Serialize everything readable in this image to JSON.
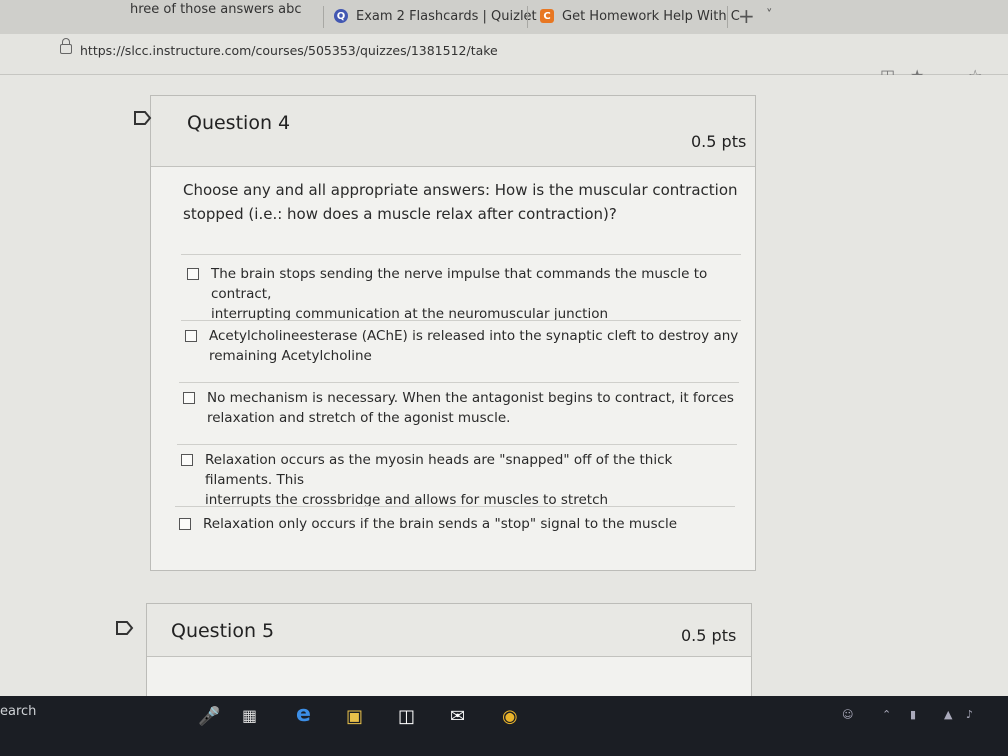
{
  "browser": {
    "tabs": [
      {
        "label": "hree of those answers abc",
        "icon": "browser-tab-icon"
      },
      {
        "label": "Exam 2 Flashcards | Quizlet",
        "icon": "quizlet-icon"
      },
      {
        "label": "Get Homework Help With C",
        "icon": "chegg-icon"
      }
    ],
    "new_tab": "+",
    "tab_menu": "˅",
    "url": "https://slcc.instructure.com/courses/505353/quizzes/1381512/take"
  },
  "questions": [
    {
      "title": "Question 4",
      "points": "0.5 pts",
      "text_line1": "Choose any and all appropriate answers: How is the muscular contraction",
      "text_line2": "stopped (i.e.: how does a muscle relax after contraction)?",
      "options": [
        {
          "line1": "The brain stops sending the nerve impulse that commands the muscle to contract,",
          "line2": "interrupting communication at the neuromuscular junction"
        },
        {
          "line1": "Acetylcholineesterase (AChE) is released into the synaptic cleft to destroy any",
          "line2": "remaining Acetylcholine"
        },
        {
          "line1": "No mechanism is necessary. When the antagonist begins to contract, it forces",
          "line2": "relaxation and stretch of the agonist muscle."
        },
        {
          "line1": "Relaxation occurs as the myosin heads are \"snapped\" off of the thick filaments. This",
          "line2": "interrupts the crossbridge and allows for muscles to stretch"
        },
        {
          "line1": "Relaxation only occurs if the brain sends a \"stop\" signal to the muscle",
          "line2": ""
        }
      ]
    },
    {
      "title": "Question 5",
      "points": "0.5 pts"
    }
  ],
  "taskbar": {
    "search_text": "earch"
  }
}
